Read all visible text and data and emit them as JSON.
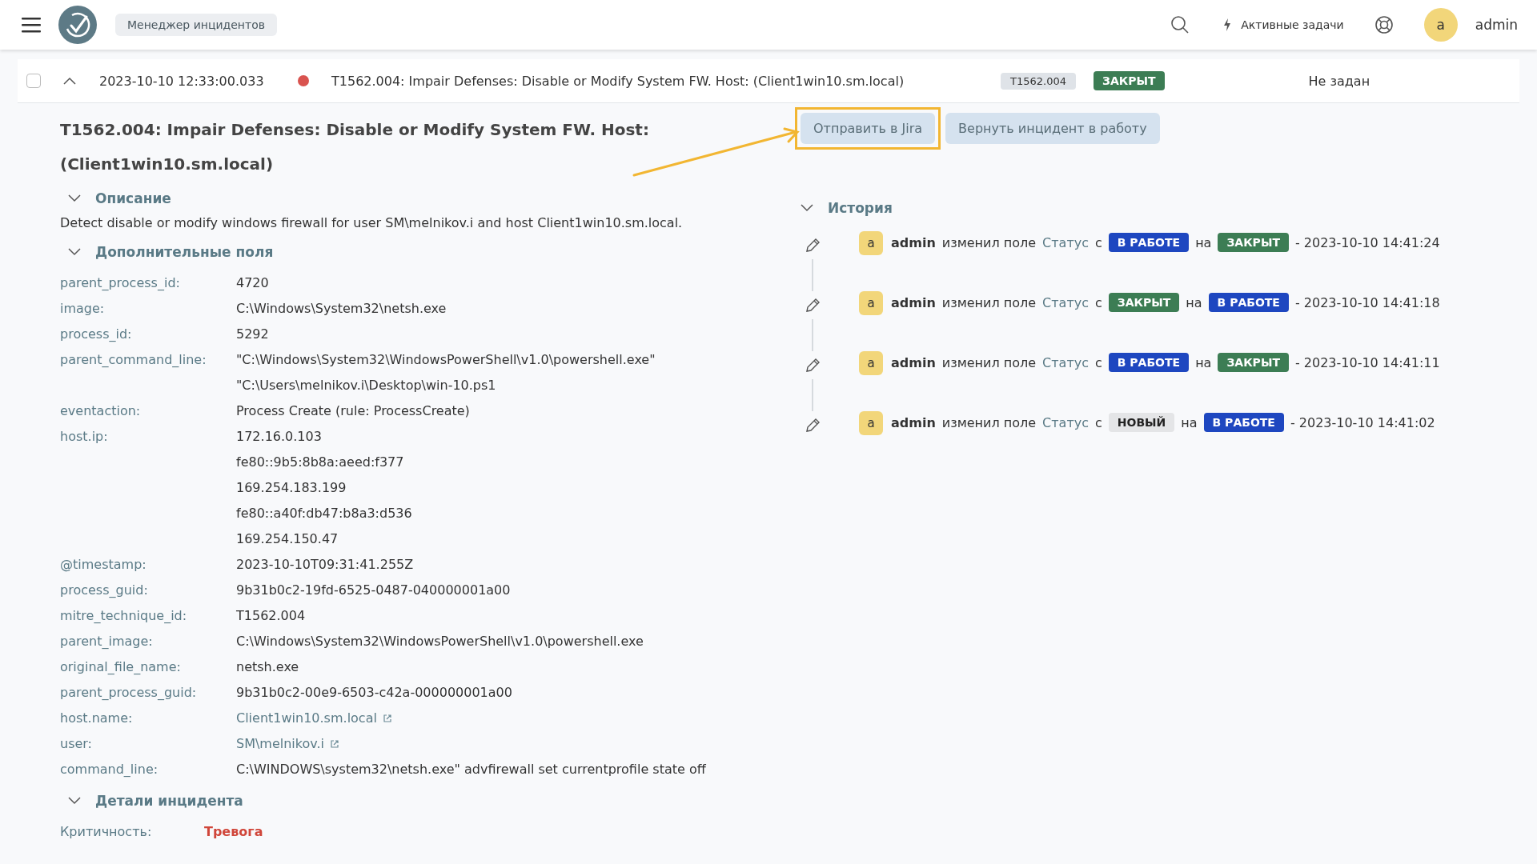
{
  "header": {
    "app_name": "Менеджер инцидентов",
    "tasks_label": "Активные задачи",
    "user_initial": "a",
    "user_name": "admin"
  },
  "incident_row": {
    "checked": false,
    "expanded": true,
    "timestamp": "2023-10-10 12:33:00.033",
    "severity": {
      "color": "#d9534f"
    },
    "title": "T1562.004: Impair Defenses: Disable or Modify System FW. Host: (Client1win10.sm.local)",
    "technique": "T1562.004",
    "status": {
      "label": "ЗАКРЫТ",
      "kind": "closed"
    },
    "assignee": "Не задан"
  },
  "detail": {
    "title": "T1562.004: Impair Defenses: Disable or Modify System FW. Host: (Client1win10.sm.local)",
    "actions": [
      {
        "label": "Отправить в Jira",
        "highlighted": true
      },
      {
        "label": "Вернуть инцидент в работу",
        "highlighted": false
      }
    ],
    "description": {
      "heading": "Описание",
      "expanded": true,
      "text": "Detect disable or modify windows firewall for user SM\\melnikov.i and host Client1win10.sm.local."
    },
    "extra_fields": {
      "heading": "Дополнительные поля",
      "expanded": true,
      "fields": [
        {
          "label": "parent_process_id:",
          "values": [
            "4720"
          ]
        },
        {
          "label": "image:",
          "values": [
            "C:\\Windows\\System32\\netsh.exe"
          ]
        },
        {
          "label": "process_id:",
          "values": [
            "5292"
          ]
        },
        {
          "label": "parent_command_line:",
          "values": [
            "\"C:\\Windows\\System32\\WindowsPowerShell\\v1.0\\powershell.exe\"",
            "\"C:\\Users\\melnikov.i\\Desktop\\win-10.ps1"
          ]
        },
        {
          "label": "eventaction:",
          "values": [
            "Process Create (rule: ProcessCreate)"
          ]
        },
        {
          "label": "host.ip:",
          "values": [
            "172.16.0.103",
            "fe80::9b5:8b8a:aeed:f377",
            "169.254.183.199",
            "fe80::a40f:db47:b8a3:d536",
            "169.254.150.47"
          ]
        },
        {
          "label": "@timestamp:",
          "values": [
            "2023-10-10T09:31:41.255Z"
          ]
        },
        {
          "label": "process_guid:",
          "values": [
            "9b31b0c2-19fd-6525-0487-040000001a00"
          ]
        },
        {
          "label": "mitre_technique_id:",
          "values": [
            "T1562.004"
          ]
        },
        {
          "label": "parent_image:",
          "values": [
            "C:\\Windows\\System32\\WindowsPowerShell\\v1.0\\powershell.exe"
          ]
        },
        {
          "label": "original_file_name:",
          "values": [
            "netsh.exe"
          ]
        },
        {
          "label": "parent_process_guid:",
          "values": [
            "9b31b0c2-00e9-6503-c42a-000000001a00"
          ]
        },
        {
          "label": "host.name:",
          "values": [
            "Client1win10.sm.local"
          ],
          "link": true
        },
        {
          "label": "user:",
          "values": [
            "SM\\melnikov.i"
          ],
          "link": true
        },
        {
          "label": "command_line:",
          "values": [
            "C:\\WINDOWS\\system32\\netsh.exe\" advfirewall set currentprofile state off"
          ]
        }
      ]
    },
    "incident_details": {
      "heading": "Детали инцидента",
      "expanded": true,
      "fields": [
        {
          "label": "Критичность:",
          "value": "Тревога"
        }
      ]
    },
    "history": {
      "heading": "История",
      "expanded": true,
      "entries": [
        {
          "avatar": "a",
          "user": "admin",
          "action": "изменил поле",
          "field": "Статус",
          "from_word": "с",
          "from": {
            "label": "В РАБОТЕ",
            "kind": "in_progress"
          },
          "to_word": "на",
          "to": {
            "label": "ЗАКРЫТ",
            "kind": "closed"
          },
          "time": "- 2023-10-10 14:41:24"
        },
        {
          "avatar": "a",
          "user": "admin",
          "action": "изменил поле",
          "field": "Статус",
          "from_word": "с",
          "from": {
            "label": "ЗАКРЫТ",
            "kind": "closed"
          },
          "to_word": "на",
          "to": {
            "label": "В РАБОТЕ",
            "kind": "in_progress"
          },
          "time": "- 2023-10-10 14:41:18"
        },
        {
          "avatar": "a",
          "user": "admin",
          "action": "изменил поле",
          "field": "Статус",
          "from_word": "с",
          "from": {
            "label": "В РАБОТЕ",
            "kind": "in_progress"
          },
          "to_word": "на",
          "to": {
            "label": "ЗАКРЫТ",
            "kind": "closed"
          },
          "time": "- 2023-10-10 14:41:11"
        },
        {
          "avatar": "a",
          "user": "admin",
          "action": "изменил поле",
          "field": "Статус",
          "from_word": "с",
          "from": {
            "label": "НОВЫЙ",
            "kind": "new"
          },
          "to_word": "на",
          "to": {
            "label": "В РАБОТЕ",
            "kind": "in_progress"
          },
          "time": "- 2023-10-10 14:41:02"
        }
      ]
    }
  }
}
